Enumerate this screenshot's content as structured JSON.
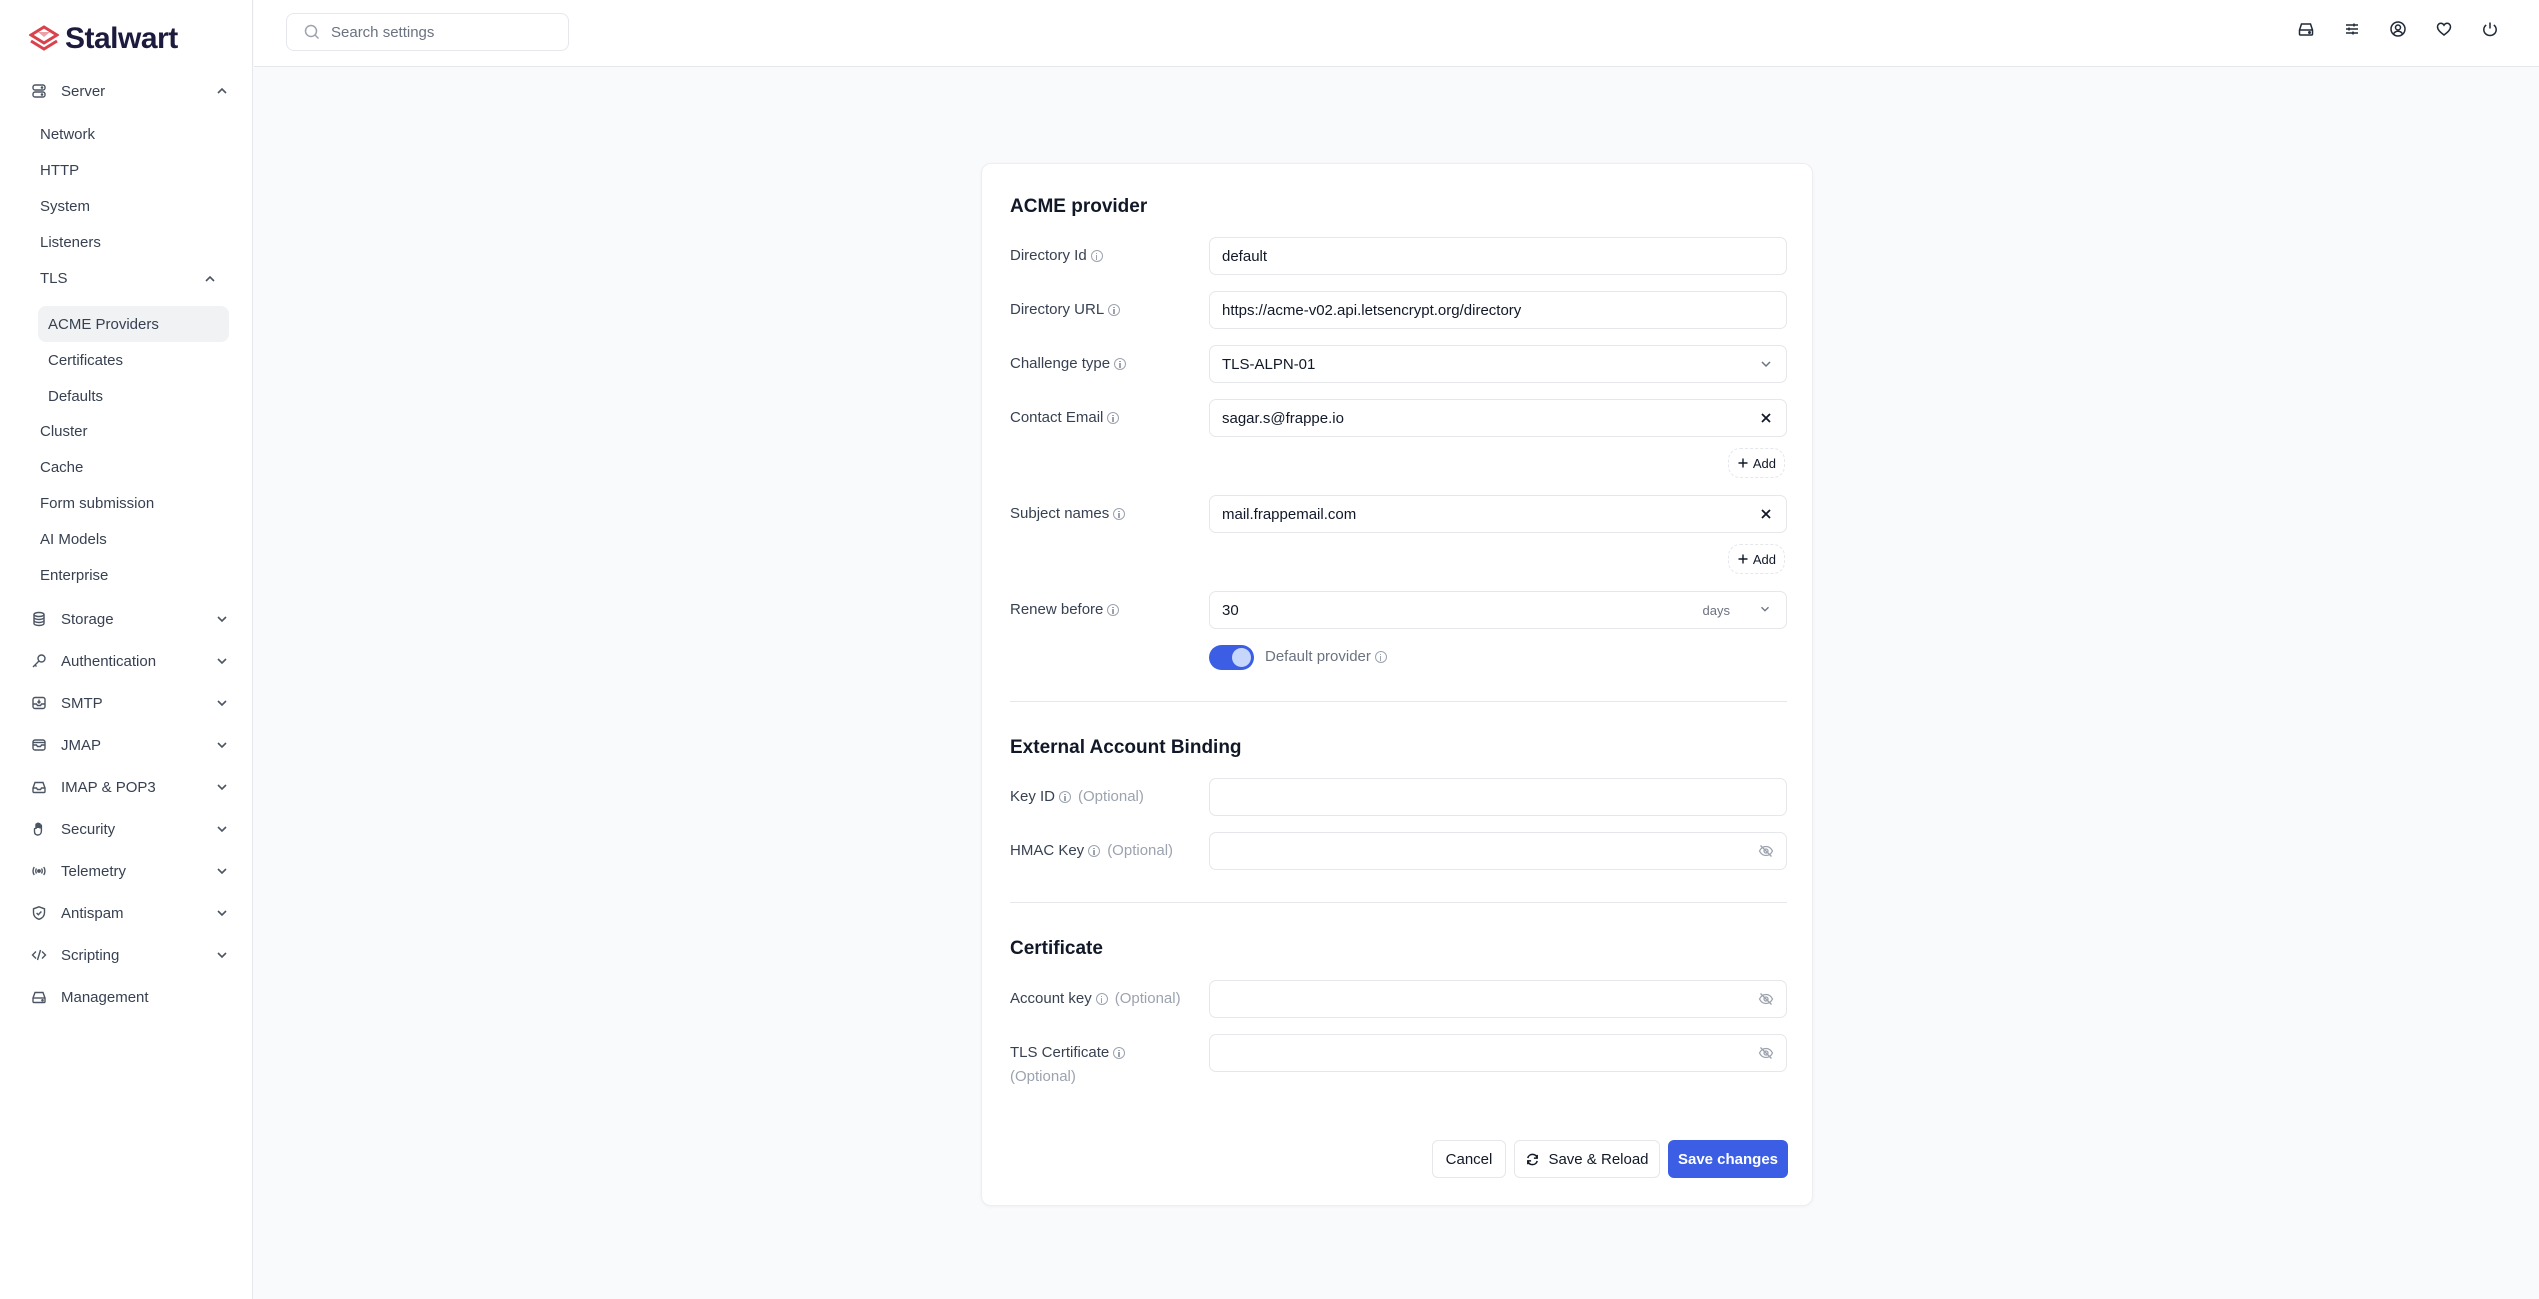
{
  "app": {
    "name": "Stalwart"
  },
  "search": {
    "placeholder": "Search settings"
  },
  "header_icons": [
    "storage-icon",
    "sliders-icon",
    "account-icon",
    "heart-icon",
    "power-icon"
  ],
  "sidebar": {
    "server": {
      "label": "Server",
      "expanded": true,
      "items": [
        "Network",
        "HTTP",
        "System",
        "Listeners"
      ],
      "tls": {
        "label": "TLS",
        "expanded": true,
        "items": [
          "ACME Providers",
          "Certificates",
          "Defaults"
        ],
        "active": "ACME Providers"
      },
      "items_after": [
        "Cluster",
        "Cache",
        "Form submission",
        "AI Models",
        "Enterprise"
      ]
    },
    "groups": [
      {
        "label": "Storage",
        "icon": "database-icon"
      },
      {
        "label": "Authentication",
        "icon": "key-icon"
      },
      {
        "label": "SMTP",
        "icon": "inbox-in-icon"
      },
      {
        "label": "JMAP",
        "icon": "inbox-stack-icon"
      },
      {
        "label": "IMAP & POP3",
        "icon": "inbox-icon"
      },
      {
        "label": "Security",
        "icon": "hand-icon"
      },
      {
        "label": "Telemetry",
        "icon": "signal-icon"
      },
      {
        "label": "Antispam",
        "icon": "shield-check-icon"
      },
      {
        "label": "Scripting",
        "icon": "code-icon"
      },
      {
        "label": "Management",
        "icon": "drive-icon"
      }
    ]
  },
  "form": {
    "acme": {
      "title": "ACME provider",
      "directory_id": {
        "label": "Directory Id",
        "value": "default"
      },
      "directory_url": {
        "label": "Directory URL",
        "value": "https://acme-v02.api.letsencrypt.org/directory"
      },
      "challenge_type": {
        "label": "Challenge type",
        "value": "TLS-ALPN-01"
      },
      "contact_email": {
        "label": "Contact Email",
        "value": "sagar.s@frappe.io"
      },
      "subject_names": {
        "label": "Subject names",
        "value": "mail.frappemail.com"
      },
      "add_label": "Add",
      "renew_before": {
        "label": "Renew before",
        "value": "30",
        "unit": "days"
      },
      "default_provider": {
        "label": "Default provider",
        "checked": true
      }
    },
    "eab": {
      "title": "External Account Binding",
      "key_id": {
        "label": "Key ID",
        "optional": "(Optional)",
        "value": ""
      },
      "hmac_key": {
        "label": "HMAC Key",
        "optional": "(Optional)",
        "value": ""
      }
    },
    "certificate": {
      "title": "Certificate",
      "account_key": {
        "label": "Account key",
        "optional": "(Optional)",
        "value": ""
      },
      "tls_certificate": {
        "label": "TLS Certificate",
        "optional": "(Optional)",
        "value": ""
      }
    },
    "buttons": {
      "cancel": "Cancel",
      "save_reload": "Save & Reload",
      "save": "Save changes"
    }
  },
  "colors": {
    "accent": "#3b5ee5",
    "brand": "#d9424b",
    "logo_text": "#1c1a3d"
  }
}
